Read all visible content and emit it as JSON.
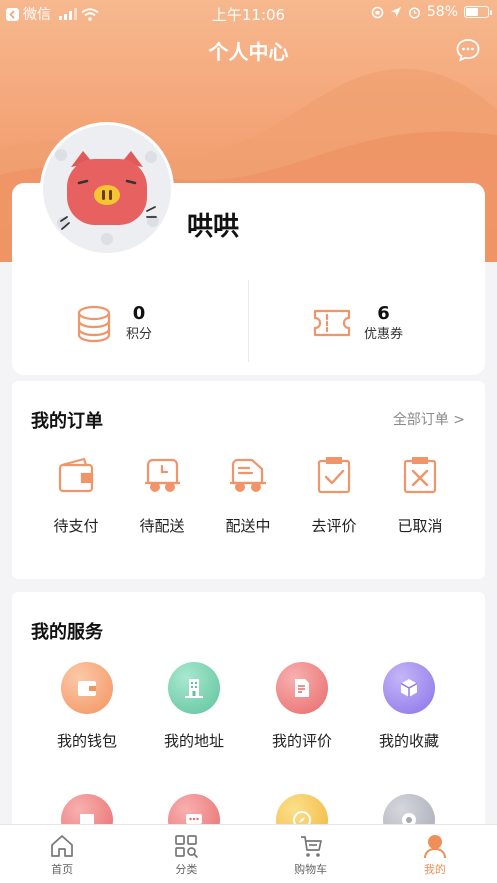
{
  "status_bar": {
    "app": "微信",
    "time": "上午11:06",
    "battery": "58%"
  },
  "header": {
    "title": "个人中心"
  },
  "profile": {
    "username": "哄哄",
    "stats": [
      {
        "value": "0",
        "label": "积分",
        "icon": "coins-icon"
      },
      {
        "value": "6",
        "label": "优惠券",
        "icon": "coupon-icon"
      }
    ]
  },
  "orders": {
    "title": "我的订单",
    "all_link": "全部订单 >",
    "items": [
      {
        "label": "待支付",
        "icon": "wallet-icon"
      },
      {
        "label": "待配送",
        "icon": "delivery-truck-clock-icon"
      },
      {
        "label": "配送中",
        "icon": "delivery-truck-icon"
      },
      {
        "label": "去评价",
        "icon": "review-check-icon"
      },
      {
        "label": "已取消",
        "icon": "cancel-x-icon"
      }
    ]
  },
  "services": {
    "title": "我的服务",
    "items": [
      {
        "label": "我的钱包",
        "icon": "wallet-icon",
        "color": "#f5a77e"
      },
      {
        "label": "我的地址",
        "icon": "building-icon",
        "color": "#7ed3b3"
      },
      {
        "label": "我的评价",
        "icon": "document-edit-icon",
        "color": "#f08a8a"
      },
      {
        "label": "我的收藏",
        "icon": "cube-icon",
        "color": "#a18df0"
      }
    ],
    "partial_row": [
      {
        "icon": "printer-icon",
        "color": "#f08a8a"
      },
      {
        "icon": "chat-dots-icon",
        "color": "#f08a8a"
      },
      {
        "icon": "compass-icon",
        "color": "#f5c55a"
      },
      {
        "icon": "gear-icon",
        "color": "#b9bcc4"
      }
    ]
  },
  "tab_bar": {
    "items": [
      {
        "label": "首页",
        "icon": "home-icon",
        "active": false
      },
      {
        "label": "分类",
        "icon": "category-grid-icon",
        "active": false
      },
      {
        "label": "购物车",
        "icon": "cart-icon",
        "active": false
      },
      {
        "label": "我的",
        "icon": "user-icon",
        "active": true
      }
    ]
  },
  "colors": {
    "accent": "#ef8f57",
    "header_gradient_top": "#f7b88e",
    "header_gradient_bottom": "#ef9262"
  }
}
